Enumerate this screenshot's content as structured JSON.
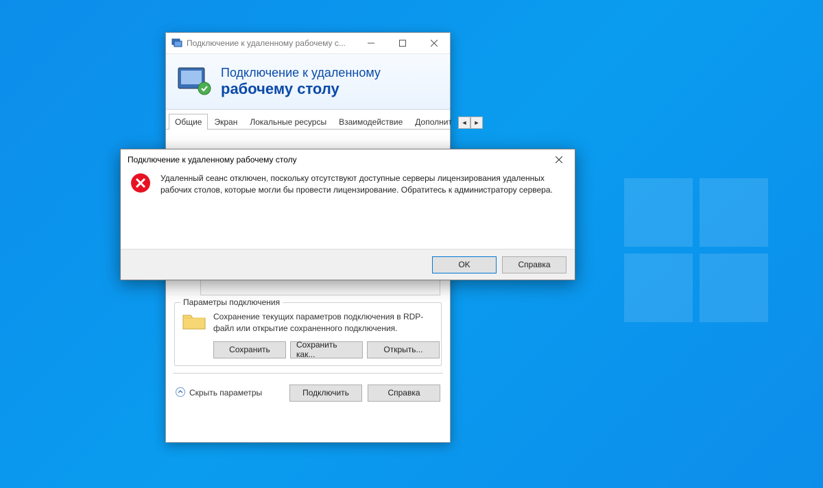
{
  "desktop": {},
  "rdp_window": {
    "title": "Подключение к удаленному рабочему с...",
    "banner_line1": "Подключение к удаленному",
    "banner_line2": "рабочему столу",
    "tabs": [
      "Общие",
      "Экран",
      "Локальные ресурсы",
      "Взаимодействие",
      "Дополнит"
    ],
    "active_tab_index": 0,
    "conn_group": {
      "legend": "Параметры подключения",
      "text": "Сохранение текущих параметров подключения в RDP-файл или открытие сохраненного подключения.",
      "save": "Сохранить",
      "save_as": "Сохранить как...",
      "open": "Открыть..."
    },
    "footer": {
      "hide_params": "Скрыть параметры",
      "connect": "Подключить",
      "help": "Справка"
    }
  },
  "error_dialog": {
    "title": "Подключение к удаленному рабочему столу",
    "message": "Удаленный сеанс отключен, поскольку отсутствуют доступные серверы лицензирования удаленных рабочих столов, которые могли бы провести лицензирование.\nОбратитесь к администратору сервера.",
    "ok": "OK",
    "help": "Справка"
  }
}
